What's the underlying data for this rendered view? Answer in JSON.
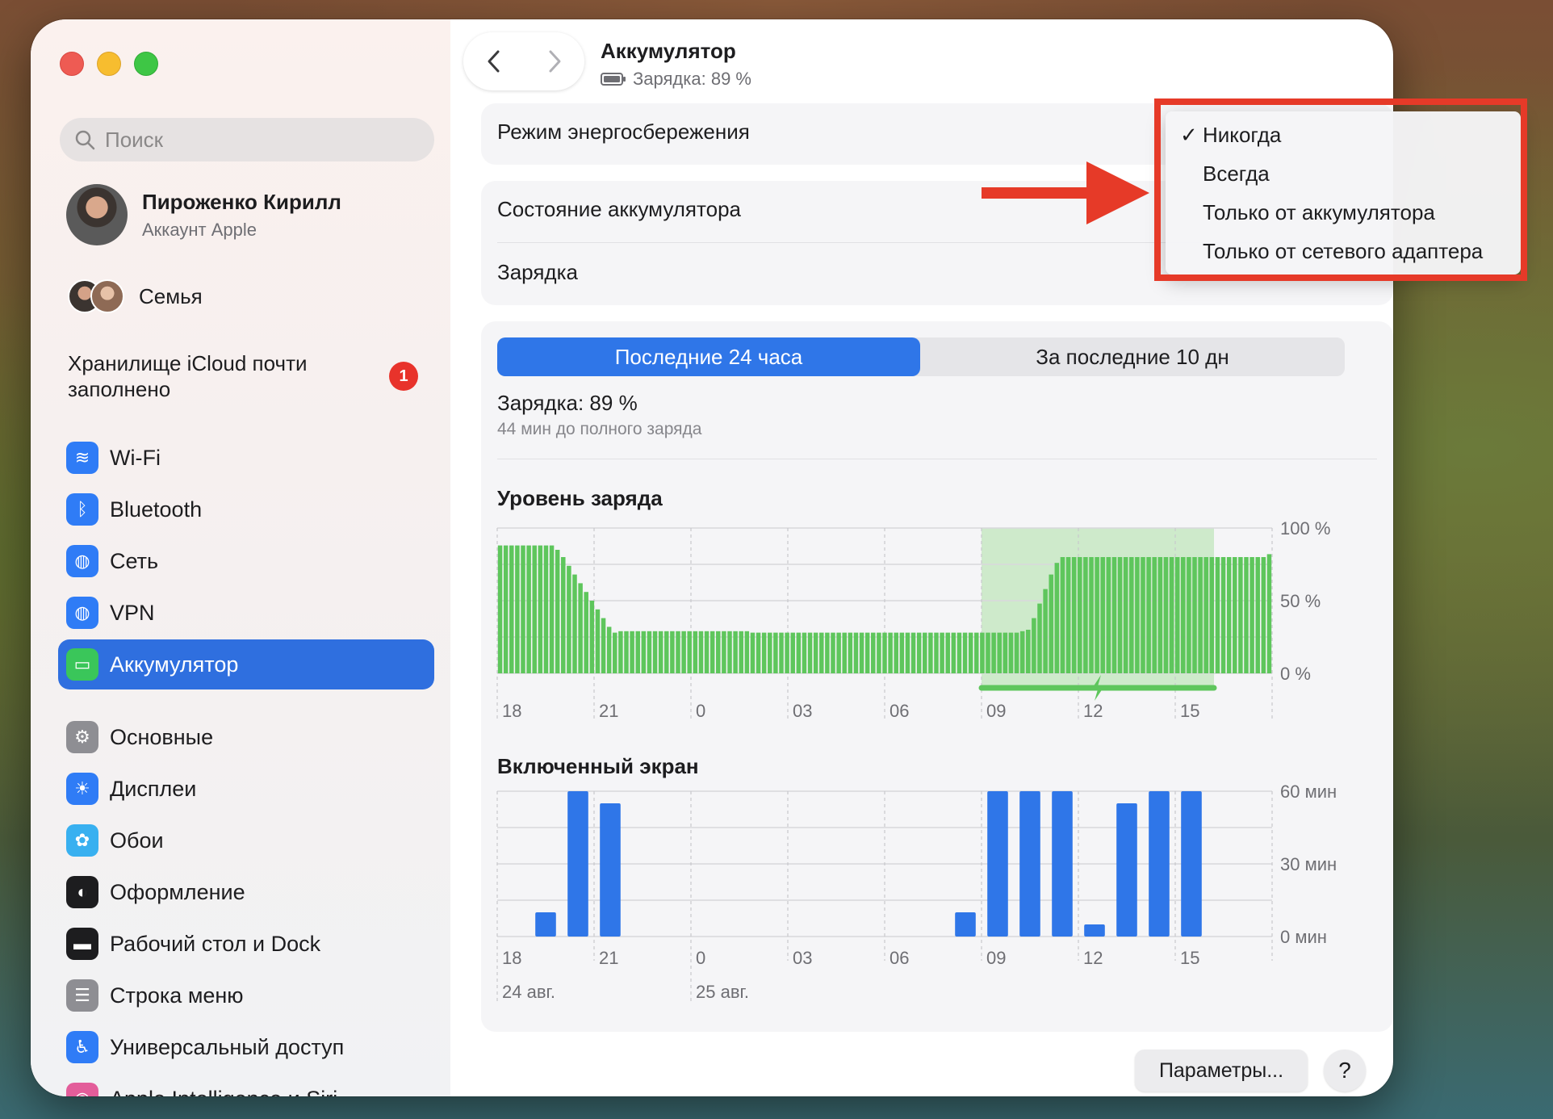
{
  "window": {
    "title": "Аккумулятор",
    "subtitle": "Зарядка: 89 %"
  },
  "search": {
    "placeholder": "Поиск"
  },
  "account": {
    "name": "Пироженко Кирилл",
    "sub": "Аккаунт Apple"
  },
  "family": {
    "label": "Семья"
  },
  "icloud": {
    "text": "Хранилище iCloud почти заполнено",
    "badge": "1"
  },
  "sidebar": {
    "items": [
      {
        "label": "Wi-Fi",
        "icon": "wifi-icon",
        "color": "#2f7cf6"
      },
      {
        "label": "Bluetooth",
        "icon": "bluetooth-icon",
        "color": "#2f7cf6"
      },
      {
        "label": "Сеть",
        "icon": "globe-icon",
        "color": "#2f7cf6"
      },
      {
        "label": "VPN",
        "icon": "vpn-globe-icon",
        "color": "#2f7cf6"
      },
      {
        "label": "Аккумулятор",
        "icon": "battery-icon",
        "color": "#3ac65a",
        "active": true
      },
      {
        "label": "Основные",
        "icon": "gear-icon",
        "color": "#8e8e93"
      },
      {
        "label": "Дисплеи",
        "icon": "sun-icon",
        "color": "#2f7cf6"
      },
      {
        "label": "Обои",
        "icon": "flower-icon",
        "color": "#38b0f0"
      },
      {
        "label": "Оформление",
        "icon": "appearance-icon",
        "color": "#1d1d1f"
      },
      {
        "label": "Рабочий стол и Dock",
        "icon": "dock-icon",
        "color": "#1d1d1f"
      },
      {
        "label": "Строка меню",
        "icon": "menubar-icon",
        "color": "#8e8e93"
      },
      {
        "label": "Универсальный доступ",
        "icon": "accessibility-icon",
        "color": "#2f7cf6"
      },
      {
        "label": "Apple Intelligence и Siri",
        "icon": "siri-icon",
        "color": "#e35d9a"
      }
    ]
  },
  "settings": {
    "low_power_label": "Режим энергосбережения",
    "health_label": "Состояние аккумулятора",
    "charging_label": "Зарядка"
  },
  "tabs": {
    "tab1": "Последние 24 часа",
    "tab2": "За последние 10 дн"
  },
  "charge": {
    "label": "Зарядка: 89 %",
    "sub": "44 мин до полного заряда"
  },
  "dropdown": {
    "items": [
      "Никогда",
      "Всегда",
      "Только от аккумулятора",
      "Только от сетевого адаптера"
    ],
    "selected": "Никогда"
  },
  "buttons": {
    "options": "Параметры...",
    "help": "?"
  },
  "chart_data": [
    {
      "type": "bar",
      "title": "Уровень заряда",
      "x_ticks": [
        "18",
        "21",
        "0",
        "03",
        "06",
        "09",
        "12",
        "15"
      ],
      "y_ticks": [
        "100 %",
        "50 %",
        "0 %"
      ],
      "ylim": [
        0,
        100
      ],
      "values": [
        88,
        88,
        88,
        88,
        88,
        88,
        88,
        88,
        88,
        88,
        85,
        80,
        74,
        68,
        62,
        56,
        50,
        44,
        38,
        32,
        28,
        29,
        29,
        29,
        29,
        29,
        29,
        29,
        29,
        29,
        29,
        29,
        29,
        29,
        29,
        29,
        29,
        29,
        29,
        29,
        29,
        29,
        29,
        29,
        28,
        28,
        28,
        28,
        28,
        28,
        28,
        28,
        28,
        28,
        28,
        28,
        28,
        28,
        28,
        28,
        28,
        28,
        28,
        28,
        28,
        28,
        28,
        28,
        28,
        28,
        28,
        28,
        28,
        28,
        28,
        28,
        28,
        28,
        28,
        28,
        28,
        28,
        28,
        28,
        28,
        28,
        28,
        28,
        28,
        28,
        28,
        29,
        30,
        38,
        48,
        58,
        68,
        76,
        80,
        80,
        80,
        80,
        80,
        80,
        80,
        80,
        80,
        80,
        80,
        80,
        80,
        80,
        80,
        80,
        80,
        80,
        80,
        80,
        80,
        80,
        80,
        80,
        80,
        80,
        80,
        80,
        80,
        80,
        80,
        80,
        80,
        80,
        80,
        80,
        82
      ],
      "charging_interval_hours": [
        15,
        22.2
      ],
      "hours_span": 24,
      "bar_color": "#5ec65c",
      "charging_color": "#bde5b8"
    },
    {
      "type": "bar",
      "title": "Включенный экран",
      "x_ticks": [
        "18",
        "21",
        "0",
        "03",
        "06",
        "09",
        "12",
        "15"
      ],
      "date_labels": [
        "24 авг.",
        "25 авг."
      ],
      "y_ticks": [
        "60 мин",
        "30 мин",
        "0 мин"
      ],
      "ylim": [
        0,
        60
      ],
      "values": [
        0,
        10,
        60,
        55,
        0,
        0,
        0,
        0,
        0,
        0,
        0,
        0,
        0,
        0,
        10,
        60,
        60,
        60,
        5,
        55,
        60,
        60
      ],
      "bar_color": "#2f76e8"
    }
  ]
}
